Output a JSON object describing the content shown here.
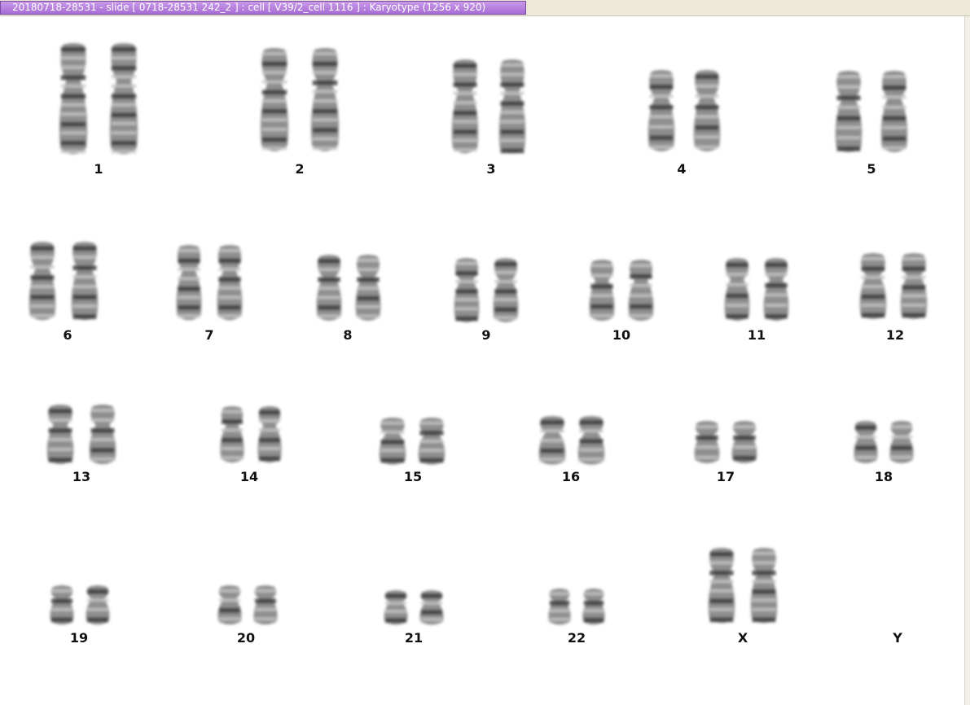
{
  "window": {
    "title": "20180718-28531 - slide [ 0718-28531 242_2 ] : cell [ V39/2_cell 1116 ] : Karyotype  (1256 x 920)"
  },
  "karyotype": {
    "chromosomes": [
      {
        "label": "1"
      },
      {
        "label": "2"
      },
      {
        "label": "3"
      },
      {
        "label": "4"
      },
      {
        "label": "5"
      },
      {
        "label": "6"
      },
      {
        "label": "7"
      },
      {
        "label": "8"
      },
      {
        "label": "9"
      },
      {
        "label": "10"
      },
      {
        "label": "11"
      },
      {
        "label": "12"
      },
      {
        "label": "13"
      },
      {
        "label": "14"
      },
      {
        "label": "15"
      },
      {
        "label": "16"
      },
      {
        "label": "17"
      },
      {
        "label": "18"
      },
      {
        "label": "19"
      },
      {
        "label": "20"
      },
      {
        "label": "21"
      },
      {
        "label": "22"
      },
      {
        "label": "X"
      },
      {
        "label": "Y"
      }
    ]
  }
}
